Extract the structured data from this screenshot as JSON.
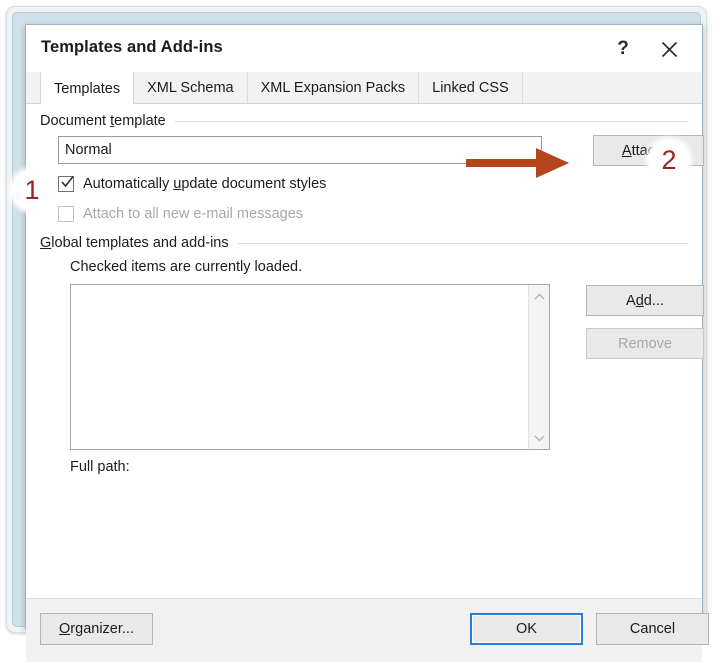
{
  "dialog": {
    "title": "Templates and Add-ins",
    "help_icon": "question-mark-icon",
    "close_icon": "close-icon"
  },
  "tabs": [
    {
      "label": "Templates",
      "active": true
    },
    {
      "label": "XML Schema",
      "active": false
    },
    {
      "label": "XML Expansion Packs",
      "active": false
    },
    {
      "label": "Linked CSS",
      "active": false
    }
  ],
  "document_template": {
    "group_label": "Document template",
    "group_label_pre": "Document ",
    "group_label_accel": "t",
    "group_label_post": "emplate",
    "input_value": "Normal",
    "input_placeholder": "",
    "attach_label_pre": "",
    "attach_label_accel": "A",
    "attach_label_post": "ttach...",
    "attach_label": "Attach...",
    "checkbox_auto_update": {
      "label": "Automatically update document styles",
      "label_pre": "Automatically ",
      "label_accel": "u",
      "label_post": "pdate document styles",
      "checked": true,
      "enabled": true
    },
    "checkbox_attach_email": {
      "label": "Attach to all new e-mail messages",
      "checked": false,
      "enabled": false
    }
  },
  "global_templates": {
    "group_label": "Global templates and add-ins",
    "group_label_pre": "",
    "group_label_accel": "G",
    "group_label_post": "lobal templates and add-ins",
    "hint": "Checked items are currently loaded.",
    "list_items": [],
    "scroll_up_icon": "chevron-up-icon",
    "scroll_down_icon": "chevron-down-icon",
    "add_label": "Add...",
    "add_label_pre": "A",
    "add_label_accel": "d",
    "add_label_post": "d...",
    "remove_label": "Remove",
    "remove_enabled": false,
    "full_path_label": "Full path:",
    "full_path_value": ""
  },
  "footer": {
    "organizer_label": "Organizer...",
    "organizer_label_pre": "",
    "organizer_label_accel": "O",
    "organizer_label_post": "rganizer...",
    "ok_label": "OK",
    "cancel_label": "Cancel"
  },
  "annotations": {
    "badge_one": "1",
    "badge_two": "2",
    "arrow_icon": "right-arrow-icon",
    "arrow_color": "#b5451b",
    "badge_text_color": "#9c2222",
    "focus_color": "#2b7cd3"
  }
}
